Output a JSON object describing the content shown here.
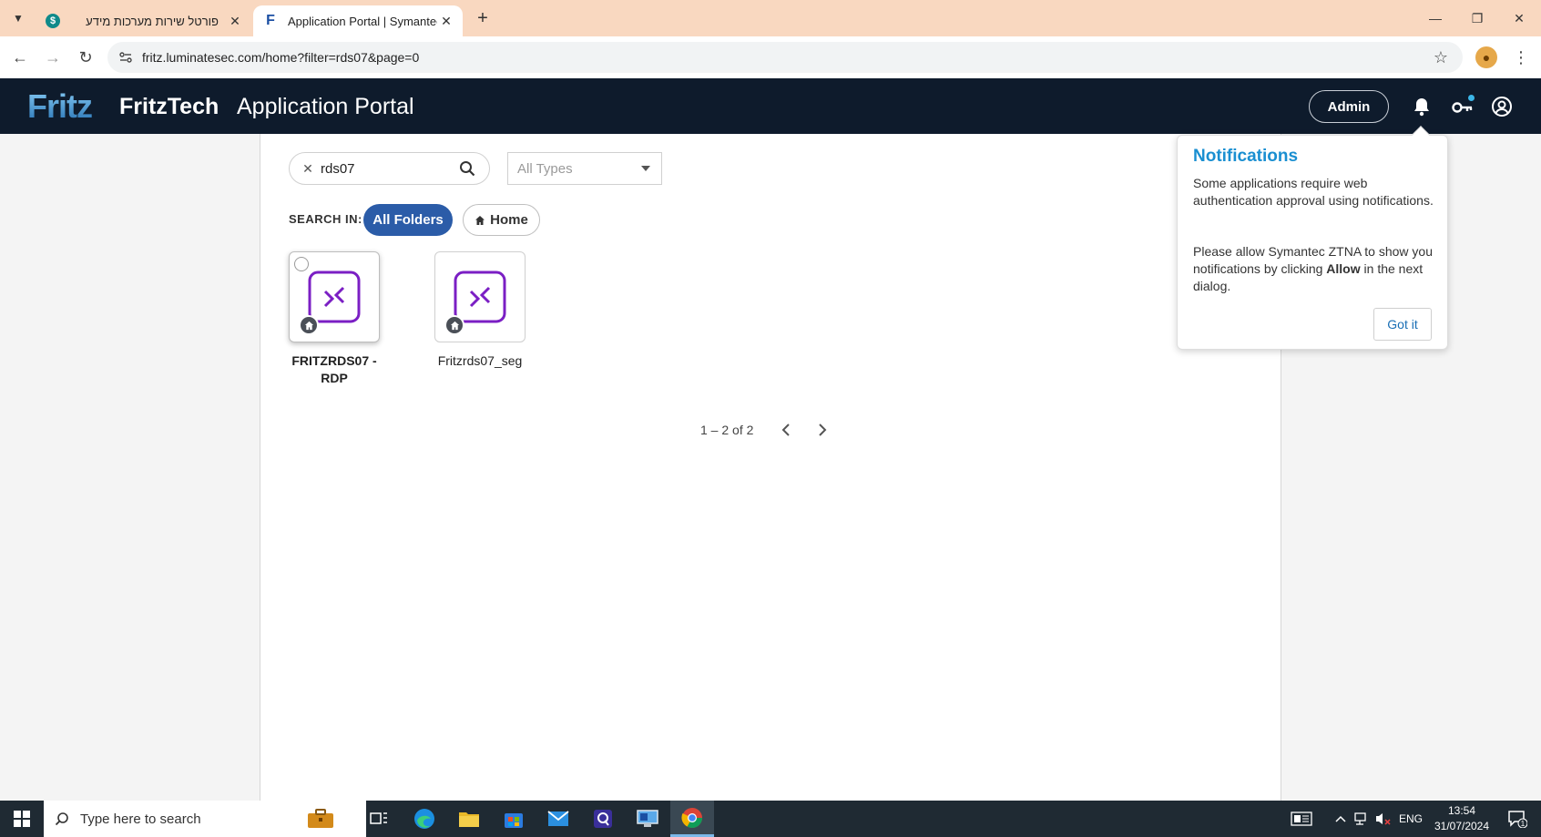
{
  "browser": {
    "tabs": [
      {
        "title": "פורטל שירות מערכות מידע",
        "favicon": "s-icon"
      },
      {
        "title": "Application Portal | Symantec Z",
        "favicon": "f-icon"
      }
    ],
    "url": "fritz.luminatesec.com/home?filter=rds07&page=0"
  },
  "header": {
    "logo_text": "Fritz",
    "brand": "FritzTech",
    "title": "Application Portal",
    "admin_label": "Admin"
  },
  "search": {
    "value": "rds07",
    "type_placeholder": "All Types"
  },
  "search_in": {
    "label": "SEARCH IN:",
    "all_folders": "All Folders",
    "home": "Home"
  },
  "apps": [
    {
      "name": "FRITZRDS07 - RDP"
    },
    {
      "name": "Fritzrds07_seg"
    }
  ],
  "pagination": {
    "range": "1 – 2 of 2"
  },
  "notification": {
    "title": "Notifications",
    "p1": "Some applications require web authentication approval using notifications.",
    "p2_before": "Please allow Symantec ZTNA to show you notifications by clicking ",
    "p2_bold": "Allow",
    "p2_after": " in the next dialog.",
    "button": "Got it"
  },
  "taskbar": {
    "search_placeholder": "Type here to search",
    "language": "ENG",
    "time": "13:54",
    "date": "31/07/2024",
    "notification_count": "1"
  },
  "colors": {
    "header_bg": "#0e1b2c",
    "accent_blue": "#2b5ca8",
    "title_blue": "#1a8fd1",
    "app_icon_purple": "#7b1fc4",
    "tabstrip_bg": "#f9d8c0"
  }
}
